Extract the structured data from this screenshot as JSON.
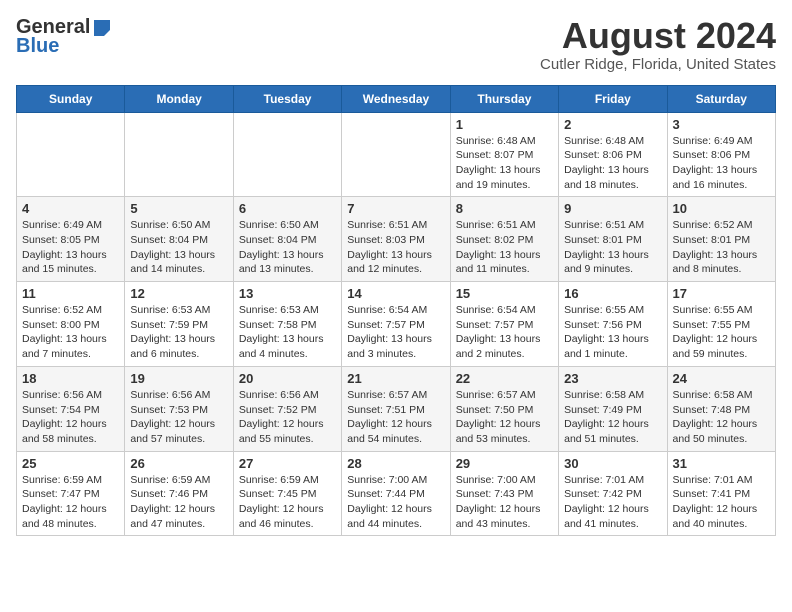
{
  "header": {
    "logo_general": "General",
    "logo_blue": "Blue",
    "month_year": "August 2024",
    "location": "Cutler Ridge, Florida, United States"
  },
  "weekdays": [
    "Sunday",
    "Monday",
    "Tuesday",
    "Wednesday",
    "Thursday",
    "Friday",
    "Saturday"
  ],
  "weeks": [
    [
      {
        "day": "",
        "info": ""
      },
      {
        "day": "",
        "info": ""
      },
      {
        "day": "",
        "info": ""
      },
      {
        "day": "",
        "info": ""
      },
      {
        "day": "1",
        "info": "Sunrise: 6:48 AM\nSunset: 8:07 PM\nDaylight: 13 hours\nand 19 minutes."
      },
      {
        "day": "2",
        "info": "Sunrise: 6:48 AM\nSunset: 8:06 PM\nDaylight: 13 hours\nand 18 minutes."
      },
      {
        "day": "3",
        "info": "Sunrise: 6:49 AM\nSunset: 8:06 PM\nDaylight: 13 hours\nand 16 minutes."
      }
    ],
    [
      {
        "day": "4",
        "info": "Sunrise: 6:49 AM\nSunset: 8:05 PM\nDaylight: 13 hours\nand 15 minutes."
      },
      {
        "day": "5",
        "info": "Sunrise: 6:50 AM\nSunset: 8:04 PM\nDaylight: 13 hours\nand 14 minutes."
      },
      {
        "day": "6",
        "info": "Sunrise: 6:50 AM\nSunset: 8:04 PM\nDaylight: 13 hours\nand 13 minutes."
      },
      {
        "day": "7",
        "info": "Sunrise: 6:51 AM\nSunset: 8:03 PM\nDaylight: 13 hours\nand 12 minutes."
      },
      {
        "day": "8",
        "info": "Sunrise: 6:51 AM\nSunset: 8:02 PM\nDaylight: 13 hours\nand 11 minutes."
      },
      {
        "day": "9",
        "info": "Sunrise: 6:51 AM\nSunset: 8:01 PM\nDaylight: 13 hours\nand 9 minutes."
      },
      {
        "day": "10",
        "info": "Sunrise: 6:52 AM\nSunset: 8:01 PM\nDaylight: 13 hours\nand 8 minutes."
      }
    ],
    [
      {
        "day": "11",
        "info": "Sunrise: 6:52 AM\nSunset: 8:00 PM\nDaylight: 13 hours\nand 7 minutes."
      },
      {
        "day": "12",
        "info": "Sunrise: 6:53 AM\nSunset: 7:59 PM\nDaylight: 13 hours\nand 6 minutes."
      },
      {
        "day": "13",
        "info": "Sunrise: 6:53 AM\nSunset: 7:58 PM\nDaylight: 13 hours\nand 4 minutes."
      },
      {
        "day": "14",
        "info": "Sunrise: 6:54 AM\nSunset: 7:57 PM\nDaylight: 13 hours\nand 3 minutes."
      },
      {
        "day": "15",
        "info": "Sunrise: 6:54 AM\nSunset: 7:57 PM\nDaylight: 13 hours\nand 2 minutes."
      },
      {
        "day": "16",
        "info": "Sunrise: 6:55 AM\nSunset: 7:56 PM\nDaylight: 13 hours\nand 1 minute."
      },
      {
        "day": "17",
        "info": "Sunrise: 6:55 AM\nSunset: 7:55 PM\nDaylight: 12 hours\nand 59 minutes."
      }
    ],
    [
      {
        "day": "18",
        "info": "Sunrise: 6:56 AM\nSunset: 7:54 PM\nDaylight: 12 hours\nand 58 minutes."
      },
      {
        "day": "19",
        "info": "Sunrise: 6:56 AM\nSunset: 7:53 PM\nDaylight: 12 hours\nand 57 minutes."
      },
      {
        "day": "20",
        "info": "Sunrise: 6:56 AM\nSunset: 7:52 PM\nDaylight: 12 hours\nand 55 minutes."
      },
      {
        "day": "21",
        "info": "Sunrise: 6:57 AM\nSunset: 7:51 PM\nDaylight: 12 hours\nand 54 minutes."
      },
      {
        "day": "22",
        "info": "Sunrise: 6:57 AM\nSunset: 7:50 PM\nDaylight: 12 hours\nand 53 minutes."
      },
      {
        "day": "23",
        "info": "Sunrise: 6:58 AM\nSunset: 7:49 PM\nDaylight: 12 hours\nand 51 minutes."
      },
      {
        "day": "24",
        "info": "Sunrise: 6:58 AM\nSunset: 7:48 PM\nDaylight: 12 hours\nand 50 minutes."
      }
    ],
    [
      {
        "day": "25",
        "info": "Sunrise: 6:59 AM\nSunset: 7:47 PM\nDaylight: 12 hours\nand 48 minutes."
      },
      {
        "day": "26",
        "info": "Sunrise: 6:59 AM\nSunset: 7:46 PM\nDaylight: 12 hours\nand 47 minutes."
      },
      {
        "day": "27",
        "info": "Sunrise: 6:59 AM\nSunset: 7:45 PM\nDaylight: 12 hours\nand 46 minutes."
      },
      {
        "day": "28",
        "info": "Sunrise: 7:00 AM\nSunset: 7:44 PM\nDaylight: 12 hours\nand 44 minutes."
      },
      {
        "day": "29",
        "info": "Sunrise: 7:00 AM\nSunset: 7:43 PM\nDaylight: 12 hours\nand 43 minutes."
      },
      {
        "day": "30",
        "info": "Sunrise: 7:01 AM\nSunset: 7:42 PM\nDaylight: 12 hours\nand 41 minutes."
      },
      {
        "day": "31",
        "info": "Sunrise: 7:01 AM\nSunset: 7:41 PM\nDaylight: 12 hours\nand 40 minutes."
      }
    ]
  ]
}
